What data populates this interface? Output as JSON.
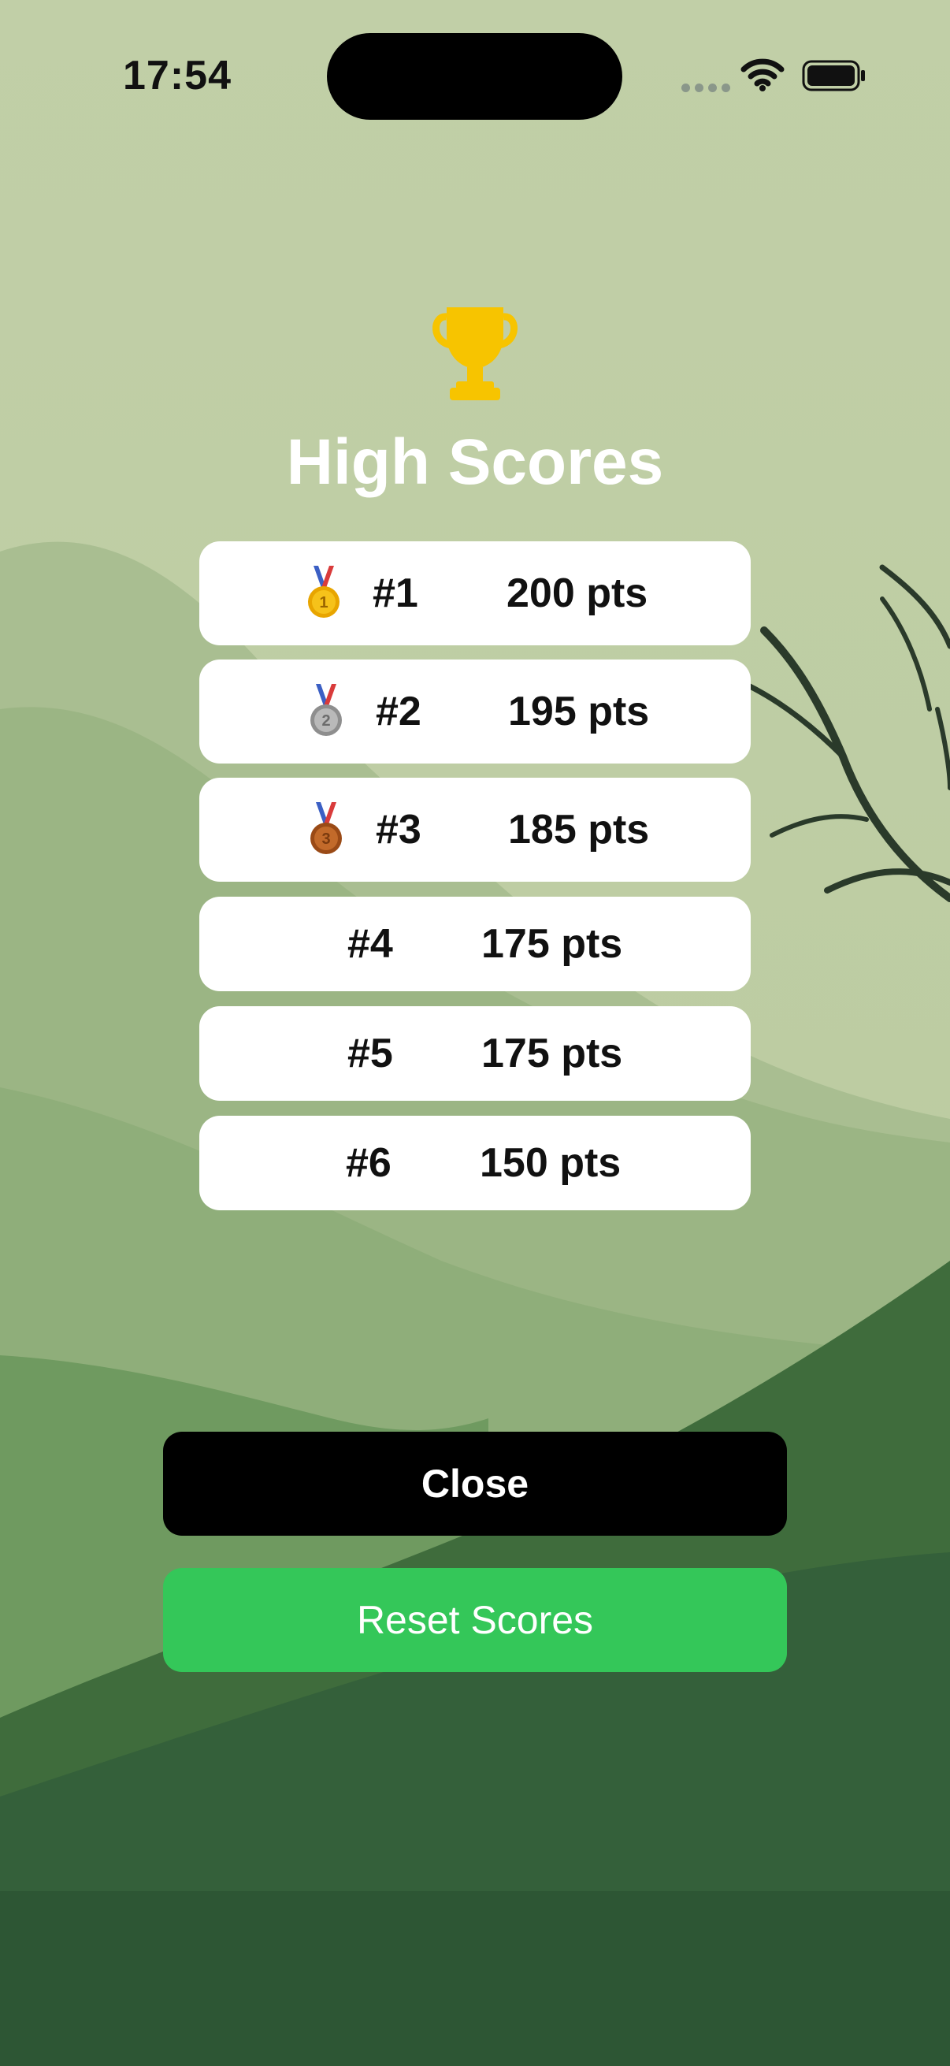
{
  "status_bar": {
    "time": "17:54"
  },
  "header": {
    "icon": "trophy-icon",
    "title": "High Scores"
  },
  "scores": [
    {
      "rank": "#1",
      "points": "200 pts",
      "medal": "gold-medal-icon",
      "medal_number": "1"
    },
    {
      "rank": "#2",
      "points": "195 pts",
      "medal": "silver-medal-icon",
      "medal_number": "2"
    },
    {
      "rank": "#3",
      "points": "185 pts",
      "medal": "bronze-medal-icon",
      "medal_number": "3"
    },
    {
      "rank": "#4",
      "points": "175 pts"
    },
    {
      "rank": "#5",
      "points": "175 pts"
    },
    {
      "rank": "#6",
      "points": "150 pts"
    }
  ],
  "buttons": {
    "close_label": "Close",
    "reset_label": "Reset Scores"
  },
  "colors": {
    "trophy": "#f7c400",
    "reset": "#34c759",
    "close": "#000000"
  }
}
